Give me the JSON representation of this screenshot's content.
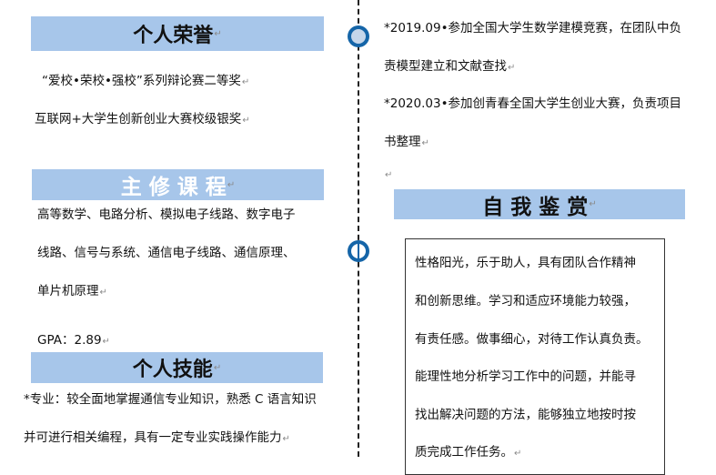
{
  "honors": {
    "title": "个人荣誉",
    "items": [
      "“爱校•荣校•强校”系列辩论赛二等奖",
      "互联网+大学生创新创业大赛校级银奖"
    ]
  },
  "courses": {
    "title": "主 修 课 程",
    "lines": [
      "高等数学、电路分析、模拟电子线路、数字电子",
      "线路、信号与系统、通信电子线路、通信原理、",
      "单片机原理"
    ],
    "gpa": "GPA：2.89"
  },
  "skills": {
    "title": "个人技能",
    "lines": [
      "*专业：较全面地掌握通信专业知识，熟悉 C 语言知识",
      "并可进行相关编程，具有一定专业实践操作能力"
    ]
  },
  "experience": {
    "lines": [
      "*2019.09•参加全国大学生数学建模竞赛，在团队中负",
      "责模型建立和文献查找",
      "*2020.03•参加创青春全国大学生创业大赛，负责项目",
      "书整理"
    ]
  },
  "self_eval": {
    "title": "自 我 鉴 赏",
    "lines": [
      "性格阳光，乐于助人，具有团队合作精神",
      "和创新思维。学习和适应环境能力较强，",
      "有责任感。做事细心，对待工作认真负责。",
      "能理性地分析学习工作中的问题，并能寻",
      "找出解决问题的方法，能够独立地按时按",
      "质完成工作任务。"
    ]
  },
  "marks": {
    "paragraph": "↵"
  },
  "colors": {
    "header_bg": "#a7c6ea",
    "node_blue": "#1565a8"
  }
}
